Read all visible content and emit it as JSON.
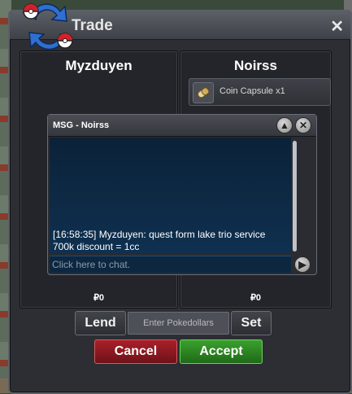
{
  "window": {
    "title": "Trade",
    "close_icon": "close-icon",
    "logo_icon": "trade-arrows-pokeball-icon"
  },
  "left_panel": {
    "player_name": "Myzduyen",
    "money": "₽0"
  },
  "right_panel": {
    "player_name": "Noirss",
    "money": "₽0",
    "items": [
      {
        "name": "Coin Capsule",
        "quantity": "x1",
        "icon": "coin-capsule-icon"
      }
    ]
  },
  "chat": {
    "title": "MSG - Noirss",
    "messages": [
      "[16:58:35] Myzduyen: quest form lake trio service 700k discount = 1cc"
    ],
    "input_placeholder": "Click here to chat.",
    "minimize_icon": "chevron-up-icon",
    "close_icon": "close-circle-icon",
    "send_icon": "play-arrow-icon"
  },
  "controls": {
    "lend_label": "Lend",
    "pokedollars_placeholder": "Enter Pokedollars",
    "set_label": "Set",
    "cancel_label": "Cancel",
    "accept_label": "Accept"
  },
  "colors": {
    "cancel": "#a8202a",
    "accept": "#3aa02e",
    "chat_bg": "#0f3050"
  }
}
